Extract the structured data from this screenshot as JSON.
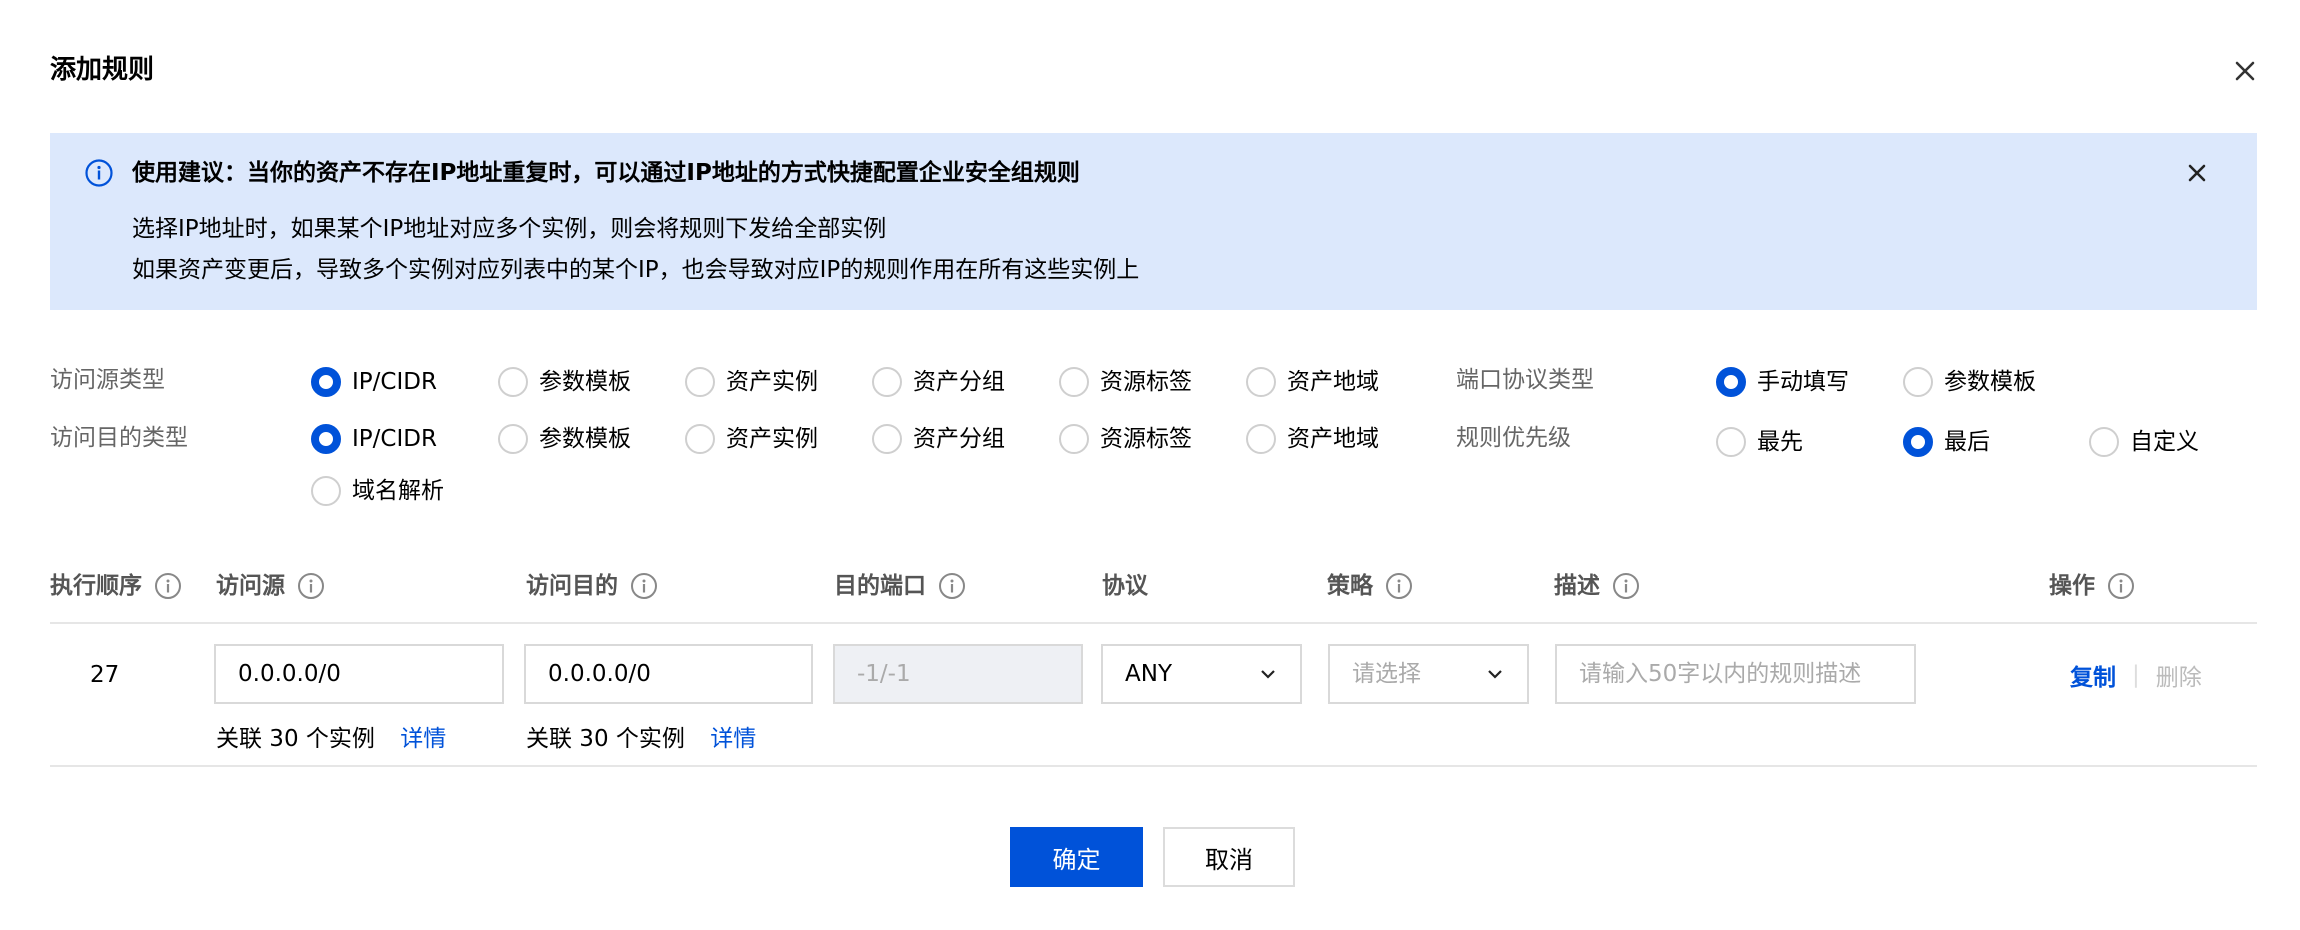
{
  "dialog": {
    "title": "添加规则"
  },
  "notice": {
    "title": "使用建议：当你的资产不存在IP地址重复时，可以通过IP地址的方式快捷配置企业安全组规则",
    "line1": "选择IP地址时，如果某个IP地址对应多个实例，则会将规则下发给全部实例",
    "line2": "如果资产变更后，导致多个实例对应列表中的某个IP，也会导致对应IP的规则作用在所有这些实例上"
  },
  "source_type": {
    "label": "访问源类型",
    "selected": "IP/CIDR",
    "options": [
      "IP/CIDR",
      "参数模板",
      "资产实例",
      "资产分组",
      "资源标签",
      "资产地域"
    ]
  },
  "dest_type": {
    "label": "访问目的类型",
    "selected": "IP/CIDR",
    "options": [
      "IP/CIDR",
      "参数模板",
      "资产实例",
      "资产分组",
      "资源标签",
      "资产地域",
      "域名解析"
    ]
  },
  "port_protocol_type": {
    "label": "端口协议类型",
    "selected": "手动填写",
    "options": [
      "手动填写",
      "参数模板"
    ]
  },
  "rule_priority": {
    "label": "规则优先级",
    "selected": "最后",
    "options": [
      "最先",
      "最后",
      "自定义"
    ]
  },
  "table": {
    "headers": {
      "order": "执行顺序",
      "source": "访问源",
      "dest": "访问目的",
      "port": "目的端口",
      "protocol": "协议",
      "policy": "策略",
      "desc": "描述",
      "ops": "操作"
    },
    "row": {
      "order": "27",
      "source_value": "0.0.0.0/0",
      "dest_value": "0.0.0.0/0",
      "port_value": "-1/-1",
      "protocol_value": "ANY",
      "policy_placeholder": "请选择",
      "desc_placeholder": "请输入50字以内的规则描述",
      "source_assoc": "关联 30 个实例",
      "dest_assoc": "关联 30 个实例",
      "detail_link": "详情",
      "copy": "复制",
      "delete": "删除"
    }
  },
  "footer": {
    "confirm": "确定",
    "cancel": "取消"
  },
  "colors": {
    "primary": "#0052d9",
    "notice_bg": "#dce8fc"
  }
}
